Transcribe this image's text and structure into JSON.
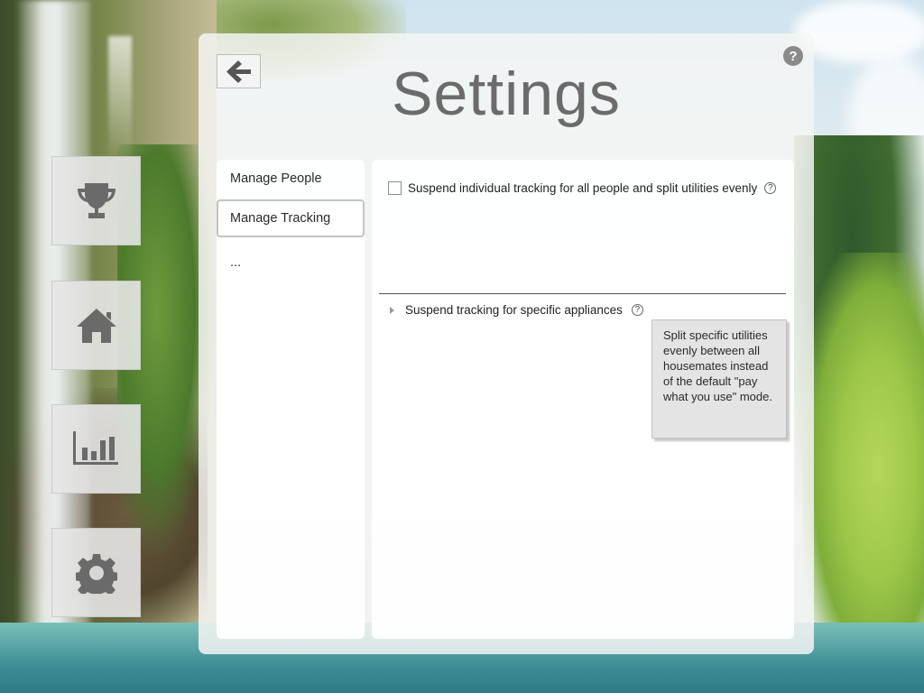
{
  "page": {
    "title": "Settings"
  },
  "header": {
    "back_icon": "arrow-left-icon",
    "help_icon": "help-circle-icon",
    "help_label": "?"
  },
  "sidenav": {
    "items": [
      {
        "name": "trophy",
        "icon": "trophy-icon"
      },
      {
        "name": "home",
        "icon": "home-icon"
      },
      {
        "name": "stats",
        "icon": "bar-chart-icon"
      },
      {
        "name": "settings",
        "icon": "gear-icon"
      }
    ]
  },
  "settings_menu": {
    "items": [
      {
        "label": "Manage People"
      },
      {
        "label": "Manage Tracking",
        "active": true
      },
      {
        "label": "..."
      }
    ]
  },
  "tracking": {
    "suspend_all": {
      "label": "Suspend individual tracking for all people and split utilities evenly",
      "checked": false,
      "help": "?"
    },
    "suspend_specific": {
      "label": "Suspend tracking for specific appliances",
      "expanded": false,
      "help": "?"
    },
    "tooltip": "Split specific utilities evenly between all housemates instead of the default \"pay what you use\" mode."
  },
  "colors": {
    "panel": "#f5f6f4",
    "title": "#6b6b6b",
    "icon": "#6a6a6a",
    "tooltip_bg": "#e4e4e4"
  }
}
